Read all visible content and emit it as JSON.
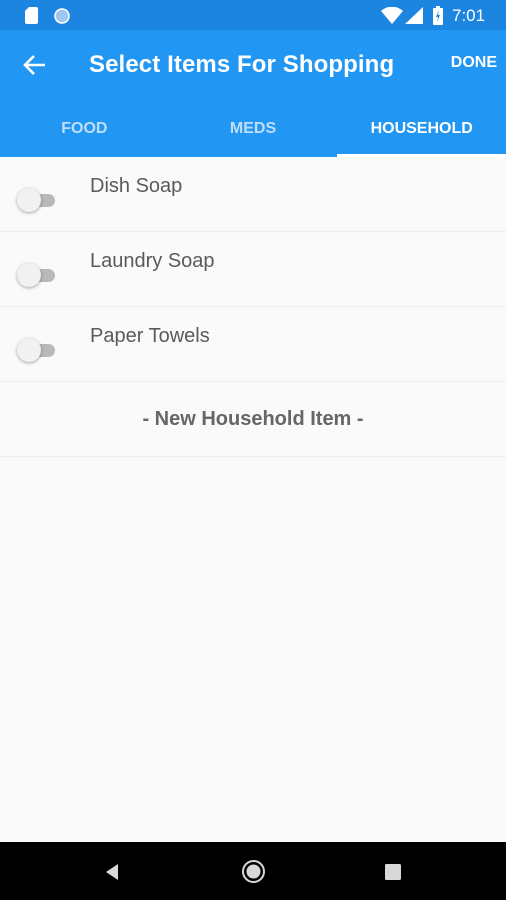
{
  "status_bar": {
    "time": "7:01",
    "icons": [
      "sd-card-icon",
      "circle-icon",
      "wifi-icon",
      "signal-icon",
      "battery-icon"
    ]
  },
  "app_bar": {
    "back_icon": "arrow-left-icon",
    "title": "Select Items For Shopping",
    "done_label": "DONE"
  },
  "tabs": [
    {
      "label": "FOOD",
      "active": false
    },
    {
      "label": "MEDS",
      "active": false
    },
    {
      "label": "HOUSEHOLD",
      "active": true
    }
  ],
  "items": [
    {
      "label": "Dish Soap",
      "checked": false
    },
    {
      "label": "Laundry Soap",
      "checked": false
    },
    {
      "label": "Paper Towels",
      "checked": false
    }
  ],
  "new_item_label": "- New Household Item -",
  "nav_bar": {
    "icons": [
      "nav-back-icon",
      "nav-home-icon",
      "nav-recent-icon"
    ]
  },
  "colors": {
    "primary": "#2196f3",
    "status_bar": "#1c85e0",
    "background": "#fafafa"
  }
}
